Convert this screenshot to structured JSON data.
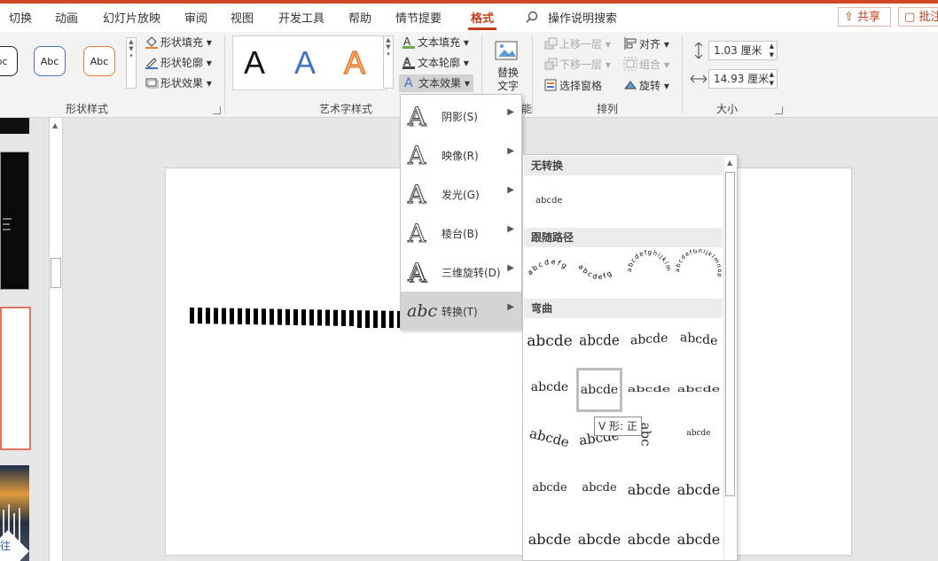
{
  "tabs": [
    "切换",
    "动画",
    "幻灯片放映",
    "审阅",
    "视图",
    "开发工具",
    "帮助",
    "情节提要",
    "格式"
  ],
  "search_label": "操作说明搜索",
  "share_label": "共享",
  "comment_label": "批注",
  "accent_color": "#c43e1c",
  "shape_styles": {
    "preview_text": [
      "bc",
      "Abc",
      "Abc"
    ],
    "fill_label": "形状填充",
    "outline_label": "形状轮廓",
    "effect_label": "形状效果",
    "group_label": "形状样式"
  },
  "wordart": {
    "samples": [
      "A",
      "A",
      "A"
    ],
    "text_fill_label": "文本填充",
    "text_outline_label": "文本轮廓",
    "text_effect_label": "文本效果",
    "group_label": "艺术字样式"
  },
  "alt_text": {
    "line1": "替换",
    "line2": "文字",
    "partial": "能"
  },
  "arrange": {
    "bring_forward": "上移一层",
    "send_backward": "下移一层",
    "selection_pane": "选择窗格",
    "align": "对齐",
    "group": "组合",
    "rotate": "旋转",
    "group_label": "排列"
  },
  "size": {
    "height": "1.03 厘米",
    "width": "14.93 厘米",
    "group_label": "大小"
  },
  "thumb_partial_text": "往",
  "effects_menu": [
    {
      "label": "阴影(S)",
      "icon": "shadow-a-icon"
    },
    {
      "label": "映像(R)",
      "icon": "reflection-a-icon"
    },
    {
      "label": "发光(G)",
      "icon": "glow-a-icon"
    },
    {
      "label": "棱台(B)",
      "icon": "bevel-a-icon"
    },
    {
      "label": "三维旋转(D)",
      "icon": "3d-rotation-a-icon"
    },
    {
      "label": "转换(T)",
      "icon": "transform-abc-icon"
    }
  ],
  "transform_icon_text": "abc",
  "gallery": {
    "no_transform_header": "无转换",
    "no_transform_sample": "abcde",
    "follow_path_header": "跟随路径",
    "path_samples": [
      "abcdefg",
      "abcdefg",
      "abcdefghijklm",
      "abcdefGhijklmnop"
    ],
    "warp_header": "弯曲",
    "warp_rows": [
      [
        "abcde",
        "abcde",
        "abcde",
        "abcde"
      ],
      [
        "abcde",
        "abcde",
        "abcde",
        "abcde"
      ],
      [
        "abcde",
        "abcde",
        "abcde",
        "abcde"
      ],
      [
        "abcde",
        "abcde",
        "abcde",
        "abcde"
      ],
      [
        "abcde",
        "abcde",
        "abcde",
        "abcde"
      ]
    ],
    "warp_partial_sample": "abc"
  },
  "tooltip": "V 形: 正"
}
